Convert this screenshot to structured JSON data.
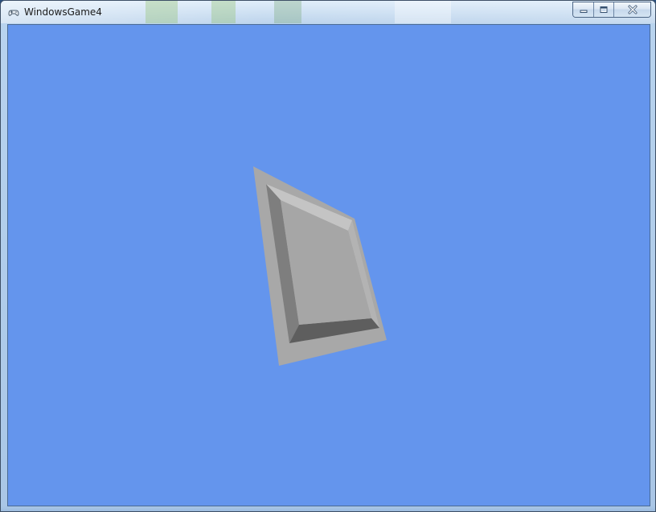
{
  "window": {
    "title": "WindowsGame4",
    "app_icon": "gamepad-icon"
  },
  "caption_buttons": {
    "minimize_icon": "minimize-icon",
    "maximize_icon": "maximize-icon",
    "close_icon": "close-icon"
  },
  "game": {
    "background_color": "#6495ed",
    "object": "beveled-gray-tile"
  }
}
